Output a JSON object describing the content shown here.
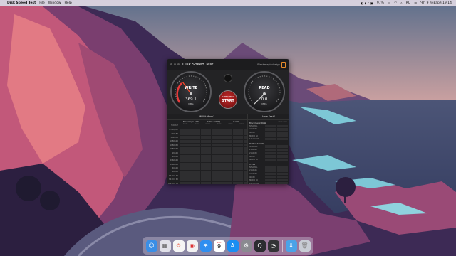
{
  "menubar": {
    "app_name": "Disk Speed Test",
    "menus": [
      "File",
      "Window",
      "Help"
    ],
    "battery": "97%",
    "input_source": "RU",
    "datetime": "Чт, 9 января 19:14"
  },
  "window": {
    "title": "Disk Speed Test",
    "brand": "Blackmagicdesign"
  },
  "gauges": {
    "write": {
      "label": "WRITE",
      "value": "369.1",
      "unit": "MB/s",
      "level": 0.37
    },
    "read": {
      "label": "READ",
      "value": "0.0",
      "unit": "MB/s",
      "level": 0.0
    }
  },
  "start_button": {
    "top_label": "SPEED TEST",
    "label": "START"
  },
  "will_it_work": {
    "title": "Will it Work?",
    "format_col": "FORMAT",
    "columns": [
      {
        "name": "Blackmagic RAW",
        "sub": [
          "WRITE",
          "READ"
        ]
      },
      {
        "name": "ProRes 422 HQ",
        "sub": [
          "WRITE",
          "READ"
        ]
      },
      {
        "name": "H.265",
        "sub": [
          "WRITE",
          "READ"
        ]
      }
    ],
    "rows": [
      "NTSC/PAL",
      "720p50",
      "1080i50",
      "1080p25",
      "1080p50",
      "1080p60",
      "2Kp25",
      "2Kp50",
      "2160p25",
      "2160p50",
      "4Kp25",
      "4Kp50",
      "8K DCI 30",
      "8K DCI 60",
      "12K DCI 30",
      "12K DCI 60"
    ]
  },
  "how_fast": {
    "title": "How Fast?",
    "col_labels": [
      "WRITE",
      "READ"
    ],
    "groups": [
      {
        "name": "Blackmagic RAW",
        "rows": [
          "NTSC/PAL",
          "2160p50",
          "4Kp50",
          "8K DCI 60",
          "12K DCI 60"
        ]
      },
      {
        "name": "ProRes 422 HQ",
        "rows": [
          "NTSC/PAL",
          "2160p25",
          "2160p50",
          "4Kp50",
          "8K DCI 30"
        ]
      },
      {
        "name": "H.265",
        "rows": [
          "NTSC/PAL",
          "2160p25",
          "2160p50",
          "4Kp50",
          "8K DCI 30",
          "12K DCI 60"
        ]
      }
    ]
  },
  "dock": {
    "apps": [
      {
        "name": "Finder",
        "icon": "finder-icon",
        "color": "#3a8ee6"
      },
      {
        "name": "Launchpad",
        "icon": "launchpad-icon",
        "color": "#e0e0e8"
      },
      {
        "name": "Photos",
        "icon": "photos-icon",
        "color": "#f5f5f5"
      },
      {
        "name": "Chrome",
        "icon": "chrome-icon",
        "color": "#f2f2f2"
      },
      {
        "name": "Safari",
        "icon": "safari-icon",
        "color": "#2f8ef0"
      },
      {
        "name": "App Store",
        "icon": "appstore-icon",
        "color": "#1b8ef2"
      },
      {
        "name": "System Preferences",
        "icon": "settings-icon",
        "color": "#8a8a90"
      },
      {
        "name": "QuickTime",
        "icon": "quicktime-icon",
        "color": "#2c2c30"
      },
      {
        "name": "Disk Speed Test",
        "icon": "diskspeed-icon",
        "color": "#333336"
      }
    ],
    "calendar_month": "ЯНВ.",
    "calendar_day": "9",
    "folders": [
      {
        "name": "Downloads",
        "icon": "downloads-folder-icon",
        "color": "#4aa3e8"
      },
      {
        "name": "Trash",
        "icon": "trash-icon",
        "color": "#c8ccd4"
      }
    ]
  }
}
